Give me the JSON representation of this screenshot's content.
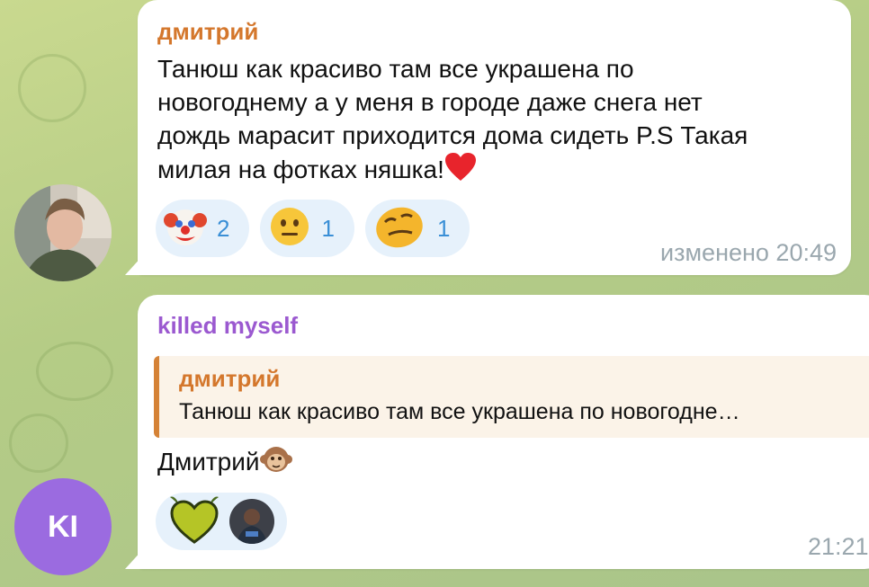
{
  "colors": {
    "sender1": "#d4772c",
    "sender2": "#9b59d0",
    "reaction_bg": "#e6f1fb",
    "reaction_count": "#3a8fd6",
    "time": "#9aa7ae",
    "reply_border": "#d58236",
    "avatar2_bg": "#9b6be0"
  },
  "message1": {
    "sender": "дмитрий",
    "text_lines": [
      "Танюш как красиво там все украшена по",
      "новогоднему а у меня в городе даже снега нет",
      "дождь марасит приходится дома сидеть P.S Такая",
      "милая на фотках няшка!"
    ],
    "heart_icon": "red-heart-icon",
    "reactions": [
      {
        "icon": "clown-face-icon",
        "count": "2"
      },
      {
        "icon": "neutral-face-icon",
        "count": "1"
      },
      {
        "icon": "woozy-face-icon",
        "count": "1"
      }
    ],
    "time": "изменено 20:49"
  },
  "message2": {
    "sender": "killed myself",
    "reply": {
      "sender": "дмитрий",
      "text": "Танюш как красиво там все украшена по новогодне…"
    },
    "text": "Дмитрий",
    "text_icon": "monkey-face-icon",
    "reaction_icons": [
      "green-heart-icon",
      "user-avatar-icon"
    ],
    "time": "21:21",
    "avatar_initials": "KI"
  }
}
